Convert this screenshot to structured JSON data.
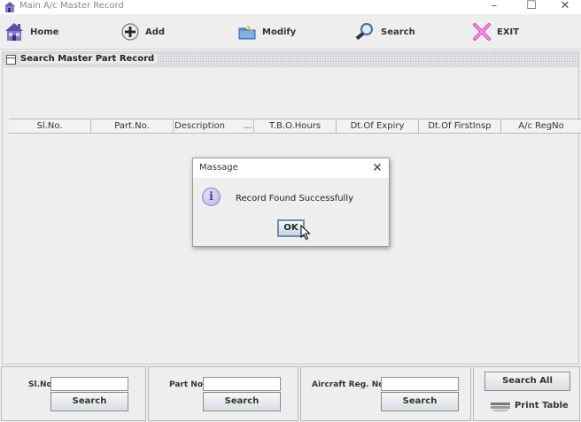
{
  "window": {
    "title": "Main A/c Master Record",
    "minimize": "–",
    "maximize": "☐",
    "close": "✕"
  },
  "toolbar": {
    "home": {
      "label": "Home",
      "icon": "house-icon"
    },
    "add": {
      "label": "Add",
      "icon": "plus-icon"
    },
    "modify": {
      "label": "Modify",
      "icon": "folder-edit-icon"
    },
    "search": {
      "label": "Search",
      "icon": "magnifier-icon"
    },
    "exit": {
      "label": "EXIT",
      "icon": "cross-icon"
    }
  },
  "panel": {
    "title": "Search Master Part Record"
  },
  "table": {
    "columns": [
      "Sl.No.",
      "Part.No.",
      "Description",
      "...",
      "T.B.O.Hours",
      "Dt.Of Expiry",
      "Dt.Of FirstInsp",
      "A/c RegNo"
    ],
    "rows": []
  },
  "search_bar": {
    "slno": {
      "label": "Sl.No.",
      "value": "",
      "button": "Search"
    },
    "partno": {
      "label": "Part No.",
      "value": "",
      "button": "Search"
    },
    "aircraft": {
      "label": "Aircraft Reg. No.",
      "value": "",
      "button": "Search"
    },
    "search_all": "Search All",
    "print_table": "Print Table"
  },
  "dialog": {
    "title": "Massage",
    "message": "Record Found Successfully",
    "ok": "OK",
    "close": "✕",
    "icon_glyph": "i"
  },
  "colors": {
    "accent": "#6f8db4",
    "info_icon": "#8f86c9",
    "exit_icon": "#d94fc8"
  }
}
